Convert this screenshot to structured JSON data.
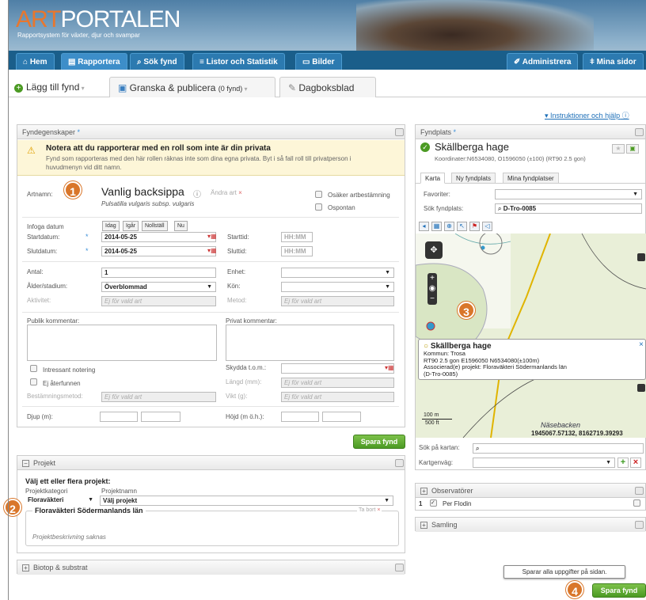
{
  "header": {
    "logo_art": "ART",
    "logo_portalen": "PORTALEN",
    "subtitle": "Rapportsystem för växter, djur och svampar"
  },
  "nav": {
    "hem": "Hem",
    "rapportera": "Rapportera",
    "sok": "Sök fynd",
    "listor": "Listor och Statistik",
    "bilder": "Bilder",
    "admin": "Administrera",
    "mina": "Mina sidor"
  },
  "subtabs": {
    "lagg": "Lägg till fynd",
    "granska": "Granska & publicera",
    "granska_count": "(0 fynd)",
    "dagbok": "Dagboksblad"
  },
  "help_link": "Instruktioner och hjälp",
  "fyndegenskaper": {
    "title": "Fyndegenskaper",
    "warning_title": "Notera att du rapporterar med en roll som inte är din privata",
    "warning_text": "Fynd som rapporteras med den här rollen räknas inte som dina egna privata. Byt i så fall roll till privatperson i huvudmenyn vid ditt namn.",
    "artnamn_label": "Artnamn:",
    "species": "Vanlig backsippa",
    "change": "Ändra art",
    "sci": "Pulsatilla vulgaris subsp. vulgaris",
    "osaker": "Osäker artbestämning",
    "ospontan": "Ospontan",
    "infoga": "Infoga datum",
    "idag": "Idag",
    "igar": "Igår",
    "nollstall": "Nollställ",
    "nu": "Nu",
    "startdatum_label": "Startdatum:",
    "startdatum": "2014-05-25",
    "starttid_label": "Starttid:",
    "time_ph": "HH:MM",
    "slutdatum_label": "Slutdatum:",
    "slutdatum": "2014-05-25",
    "sluttid_label": "Sluttid:",
    "antal_label": "Antal:",
    "antal": "1",
    "enhet_label": "Enhet:",
    "alder_label": "Ålder/stadium:",
    "alder": "Överblommad",
    "kon_label": "Kön:",
    "aktivitet_label": "Aktivitet:",
    "metod_label": "Metod:",
    "ej": "Ej för vald art",
    "publik_label": "Publik kommentar:",
    "privat_label": "Privat kommentar:",
    "intressant": "Intressant notering",
    "skydda_label": "Skydda t.o.m.:",
    "ej_aterfunnen": "Ej återfunnen",
    "langd_label": "Längd (mm):",
    "bestamning_label": "Bestämningsmetod:",
    "vikt_label": "Vikt (g):",
    "djup_label": "Djup (m):",
    "hojd_label": "Höjd (m ö.h.):"
  },
  "save": "Spara fynd",
  "projekt": {
    "title": "Projekt",
    "choose": "Välj ett eller flera projekt:",
    "kat_label": "Projektkategori",
    "namn_label": "Projektnamn",
    "kat": "Floraväkteri",
    "namn": "Välj projekt",
    "item_title": "Floraväkteri Södermanlands län",
    "remove": "Ta bort",
    "desc": "Projektbeskrivning saknas"
  },
  "biotop": {
    "title": "Biotop & substrat"
  },
  "fyndplats": {
    "title": "Fyndplats",
    "name": "Skällberga hage",
    "coords": "Koordinater:N6534080, O1596050 (±100) (RT90 2.5 gon)",
    "tabs": [
      "Karta",
      "Ny fyndplats",
      "Mina fyndplatser"
    ],
    "favoriter_label": "Favoriter:",
    "sok_label": "Sök fyndplats:",
    "sok_value": "D-Tro-0085",
    "sok_kartan": "Sök på kartan:",
    "kartgenvag": "Kartgenväg:"
  },
  "map": {
    "popup_title": "Skällberga hage",
    "popup_lines": [
      "Kommun: Trosa",
      "RT90 2.5 gon E1596050 N6534080(±100m)",
      "Associerad(e) projekt: Floraväkteri Södermanlands län",
      "(D-Tro-0085)"
    ],
    "place": "Näsebacken",
    "coords": "1945067.57132, 8162719.39293",
    "scale_m": "100 m",
    "scale_ft": "500 ft"
  },
  "observatorer": {
    "title": "Observatörer",
    "num": "1",
    "name": "Per Flodin"
  },
  "samling": {
    "title": "Samling"
  },
  "tooltip": "Sparar alla uppgifter på sidan.",
  "badges": [
    "1",
    "2",
    "3",
    "4"
  ],
  "colors": {
    "accent": "#1a5e8a",
    "green": "#4b9a23",
    "badge": "#d9762a",
    "map_bg": "#e9efd8",
    "road": "#e0b400"
  }
}
